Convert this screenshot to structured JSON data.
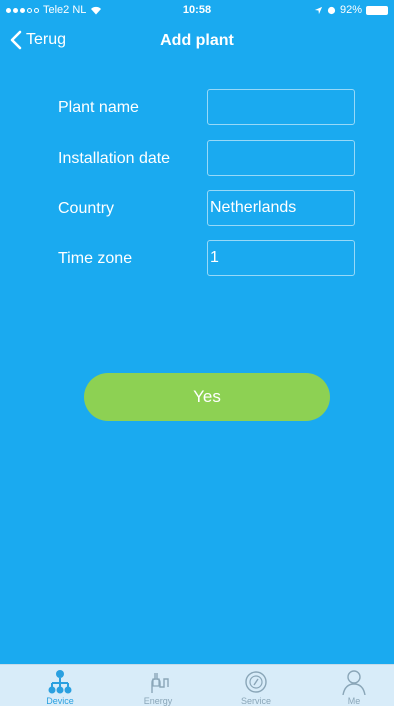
{
  "status_bar": {
    "carrier": "Tele2 NL",
    "time": "10:58",
    "battery": "92%"
  },
  "nav": {
    "back_label": "Terug",
    "title": "Add plant"
  },
  "form": {
    "plant_name": {
      "label": "Plant name",
      "value": ""
    },
    "installation_date": {
      "label": "Installation date",
      "value": ""
    },
    "country": {
      "label": "Country",
      "value": "Netherlands"
    },
    "time_zone": {
      "label": "Time zone",
      "value": "1"
    }
  },
  "submit_label": "Yes",
  "tabs": [
    {
      "label": "Device",
      "icon": "device-network-icon",
      "active": true
    },
    {
      "label": "Energy",
      "icon": "energy-icon",
      "active": false
    },
    {
      "label": "Service",
      "icon": "service-icon",
      "active": false
    },
    {
      "label": "Me",
      "icon": "person-icon",
      "active": false
    }
  ],
  "colors": {
    "background": "#1aaaf0",
    "button": "#8dd153",
    "tab_bar": "#d8ecf9",
    "tab_active": "#2aa0e0"
  }
}
